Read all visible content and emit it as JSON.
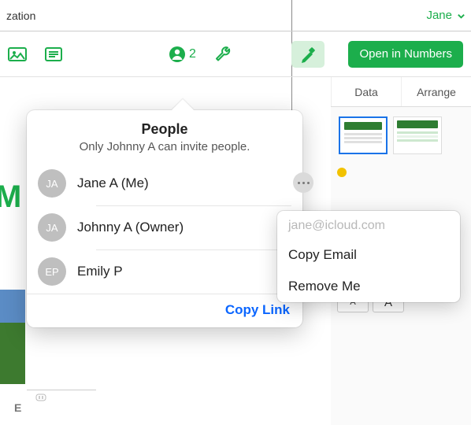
{
  "colors": {
    "accent": "#1CAE4C",
    "link": "#0b66ff",
    "gavel_bg": "#D6F0DB",
    "presence_yellow": "#F2C200",
    "presence_green": "#16B84E"
  },
  "titlebar": {
    "title_fragment": "zation",
    "user_name": "Jane"
  },
  "toolbar": {
    "collab_count": "2",
    "open_button_label": "Open in Numbers"
  },
  "right_tabs": [
    "Data",
    "Arrange"
  ],
  "panel": {
    "grid1": "1",
    "grid2": "0",
    "font_a": "A",
    "font_a2": "A"
  },
  "left": {
    "big_letter": "M",
    "col_label": "E"
  },
  "popover": {
    "title": "People",
    "subtitle": "Only Johnny A can invite people.",
    "people": [
      {
        "initials": "JA",
        "name": "Jane A (Me)"
      },
      {
        "initials": "JA",
        "name": "Johnny A (Owner)"
      },
      {
        "initials": "EP",
        "name": "Emily P"
      }
    ],
    "copy_link": "Copy Link"
  },
  "submenu": {
    "email": "jane@icloud.com",
    "items": [
      "Copy Email",
      "Remove Me"
    ]
  }
}
